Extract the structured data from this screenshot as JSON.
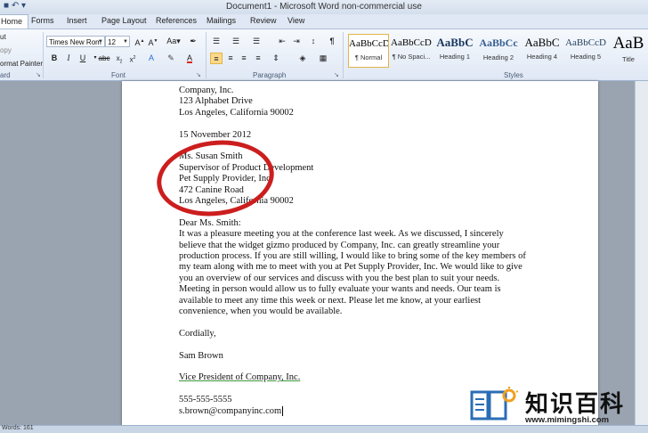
{
  "window": {
    "title": "Document1 - Microsoft Word non-commercial use"
  },
  "tabs": [
    "Home",
    "Forms",
    "Insert",
    "Page Layout",
    "References",
    "Mailings",
    "Review",
    "View"
  ],
  "ribbon": {
    "clipboard": {
      "cut": "ut",
      "copy": "opy",
      "format_painter": "ormat Painter",
      "label": "ard"
    },
    "font": {
      "name": "Times New Rom",
      "size": "12",
      "label": "Font"
    },
    "paragraph": {
      "label": "Paragraph"
    },
    "styles": {
      "label": "Styles",
      "items": [
        {
          "sample": "AaBbCcDc",
          "name": "¶ Normal"
        },
        {
          "sample": "AaBbCcDc",
          "name": "¶ No Spaci..."
        },
        {
          "sample": "AaBbC",
          "name": "Heading 1"
        },
        {
          "sample": "AaBbCc",
          "name": "Heading 2"
        },
        {
          "sample": "AaBbC",
          "name": "Heading 4"
        },
        {
          "sample": "AaBbCcD",
          "name": "Heading 5"
        },
        {
          "sample": "AaB",
          "name": "Title"
        }
      ]
    }
  },
  "document": {
    "lines": [
      "Company, Inc.",
      "123 Alphabet Drive",
      "Los Angeles, California 90002",
      "",
      "15 November 2012",
      "",
      "Ms. Susan Smith",
      "Supervisor of Product Development",
      "Pet Supply Provider, Inc.",
      "472 Canine Road",
      "Los Angeles, California 90002",
      "",
      "Dear Ms. Smith:",
      "It was a pleasure meeting you at the conference last week. As we discussed, I sincerely",
      "believe that the widget gizmo produced by Company, Inc. can greatly streamline your",
      "production process. If you are still willing, I would like to bring some of the key members of",
      "my team along with me to meet with you at Pet Supply Provider, Inc. We would like to give",
      "you an overview of our services and discuss with you the best plan to suit your needs.",
      "Meeting in person would allow us to fully evaluate your wants and needs. Our team is",
      "available to meet any time this week or next. Please let me know, at your earliest",
      "convenience, when you would be available.",
      "",
      "Cordially,",
      "",
      "Sam Brown",
      "",
      "Vice President of Company, Inc.",
      "",
      "555-555-5555",
      "s.brown@companyinc.com"
    ]
  },
  "status": {
    "words": "Words: 161"
  },
  "watermark": {
    "text": "知识百科",
    "url": "www.mimingshi.com"
  }
}
